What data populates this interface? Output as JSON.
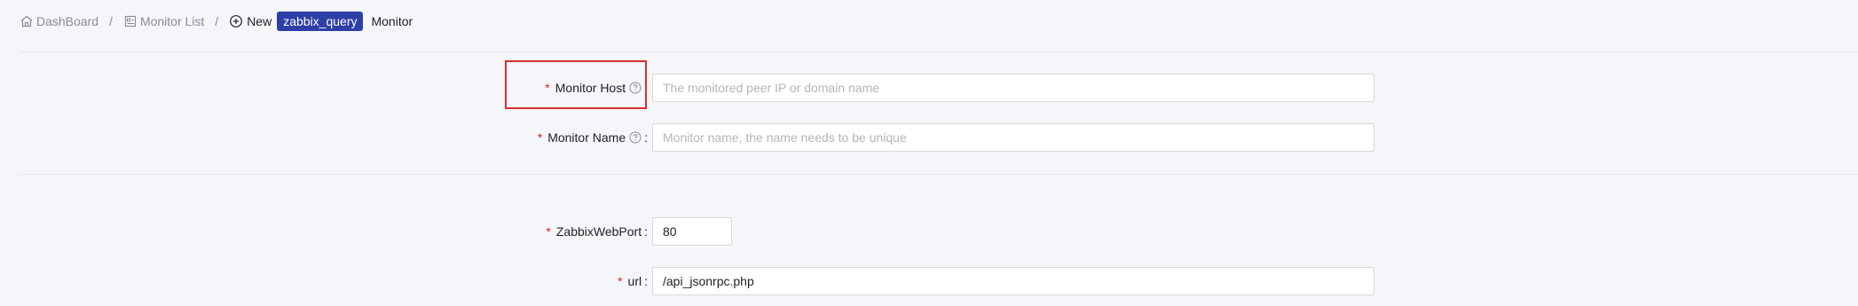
{
  "breadcrumb": {
    "dashboard": "DashBoard",
    "monitor_list": "Monitor List",
    "separator": "/",
    "new_label": "New",
    "monitor_type": "zabbix_query",
    "monitor_suffix": "Monitor"
  },
  "form": {
    "monitor_host": {
      "label": "Monitor Host",
      "required_mark": "*",
      "placeholder": "The monitored peer IP or domain name",
      "value": ""
    },
    "monitor_name": {
      "label": "Monitor Name",
      "required_mark": "*",
      "placeholder": "Monitor name, the name needs to be unique",
      "value": ""
    },
    "zabbix_web_port": {
      "label": "ZabbixWebPort",
      "required_mark": "*",
      "value": "80"
    },
    "url": {
      "label": "url",
      "required_mark": "*",
      "value": "/api_jsonrpc.php"
    },
    "colon": ":"
  },
  "colors": {
    "tag_background": "#2f3fa8",
    "required": "#e02424",
    "highlight_border": "#d93030",
    "page_background": "#f5f6f9"
  },
  "icons": [
    "home-icon",
    "monitor-list-icon",
    "plus-circle-icon",
    "question-circle-icon"
  ]
}
